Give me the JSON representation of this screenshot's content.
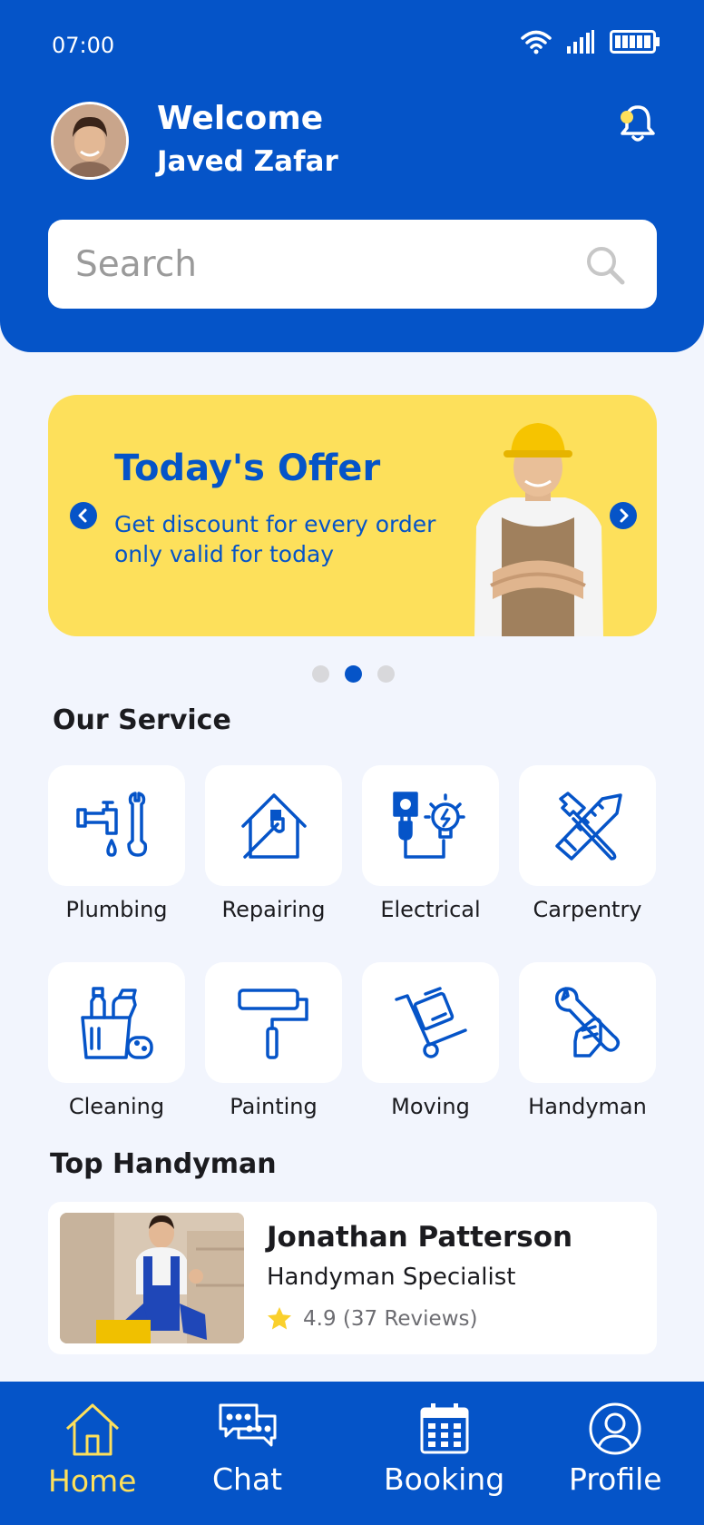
{
  "status_bar": {
    "time": "07:00"
  },
  "header": {
    "greeting": "Welcome",
    "user_name": "Javed Zafar"
  },
  "search": {
    "placeholder": "Search"
  },
  "offer": {
    "title": "Today's Offer",
    "description": "Get discount for every order only valid for today",
    "active_slide": 2,
    "slide_count": 3
  },
  "services": {
    "title": "Our Service",
    "items": [
      {
        "label": "Plumbing",
        "icon": "plumbing-icon"
      },
      {
        "label": "Repairing",
        "icon": "house-repair-icon"
      },
      {
        "label": "Electrical",
        "icon": "electrical-icon"
      },
      {
        "label": "Carpentry",
        "icon": "carpentry-tools-icon"
      },
      {
        "label": "Cleaning",
        "icon": "cleaning-supplies-icon"
      },
      {
        "label": "Painting",
        "icon": "paint-roller-icon"
      },
      {
        "label": "Moving",
        "icon": "hand-truck-icon"
      },
      {
        "label": "Handyman",
        "icon": "wrench-hand-icon"
      }
    ]
  },
  "top_handyman": {
    "title": "Top Handyman",
    "name": "Jonathan Patterson",
    "role": "Handyman Specialist",
    "rating": "4.9 (37 Reviews)"
  },
  "nav": {
    "items": [
      {
        "label": "Home",
        "icon": "home-icon",
        "active": true
      },
      {
        "label": "Chat",
        "icon": "chat-icon"
      },
      {
        "label": "Booking",
        "icon": "calendar-icon"
      },
      {
        "label": "Profile",
        "icon": "profile-icon"
      }
    ]
  },
  "colors": {
    "primary": "#0554c8",
    "accent": "#fde05b",
    "background": "#f2f5fd"
  }
}
